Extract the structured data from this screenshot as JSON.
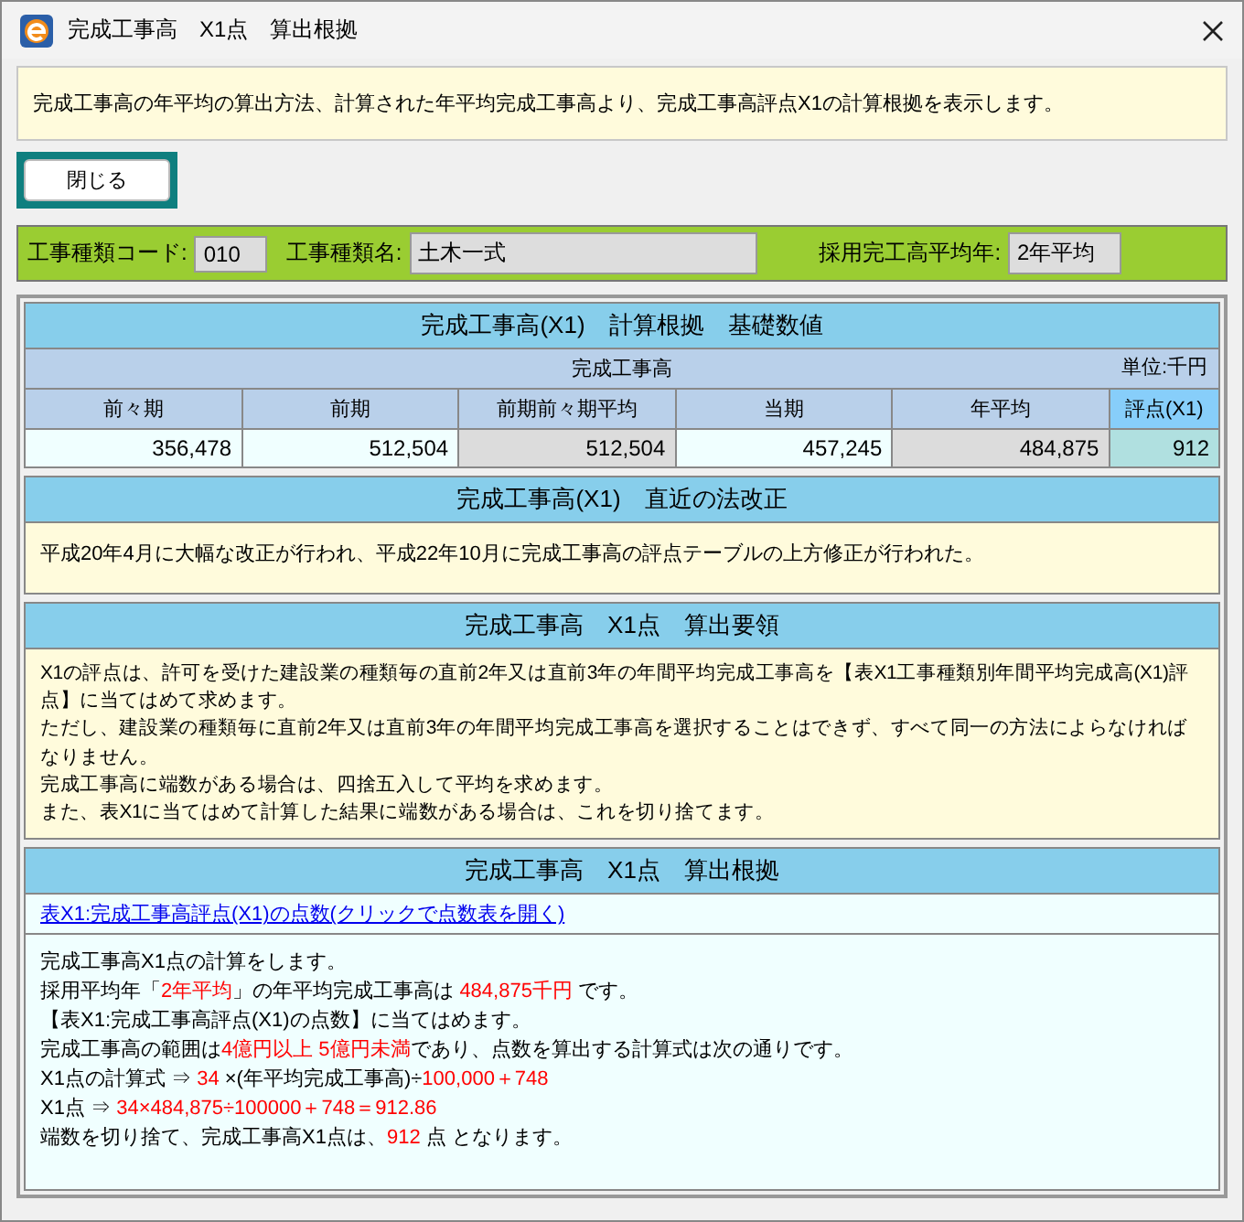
{
  "window": {
    "title": "完成工事高　X1点　算出根拠"
  },
  "description": "完成工事高の年平均の算出方法、計算された年平均完成工事高より、完成工事高評点X1の計算根拠を表示します。",
  "close_button": "閉じる",
  "info_bar": [
    {
      "label": "工事種類コード:",
      "value": "010",
      "kind": "short"
    },
    {
      "label": "工事種類名:",
      "value": "土木一式",
      "kind": "long"
    },
    {
      "label": "採用完工高平均年:",
      "value": "2年平均",
      "kind": "medium"
    }
  ],
  "basis": {
    "title": "完成工事高(X1)　計算根拠　基礎数値",
    "group_label": "完成工事高",
    "unit": "単位:千円",
    "columns": [
      {
        "label": "前々期",
        "value": "356,478",
        "kind": "input"
      },
      {
        "label": "前期",
        "value": "512,504",
        "kind": "input"
      },
      {
        "label": "前期前々期平均",
        "value": "512,504",
        "kind": "computed"
      },
      {
        "label": "当期",
        "value": "457,245",
        "kind": "input"
      },
      {
        "label": "年平均",
        "value": "484,875",
        "kind": "computed"
      },
      {
        "label": "評点(X1)",
        "value": "912",
        "kind": "score"
      }
    ]
  },
  "law": {
    "title": "完成工事高(X1)　直近の法改正",
    "text": "平成20年4月に大幅な改正が行われ、平成22年10月に完成工事高の評点テーブルの上方修正が行われた。"
  },
  "method": {
    "title": "完成工事高　X1点　算出要領",
    "lines": [
      "X1の評点は、許可を受けた建設業の種類毎の直前2年又は直前3年の年間平均完成工事高を【表X1工事種類別年間平均完成高(X1)評点】に当てはめて求めます。",
      "ただし、建設業の種類毎に直前2年又は直前3年の年間平均完成工事高を選択することはできず、すべて同一の方法によらなければなりません。",
      "完成工事高に端数がある場合は、四捨五入して平均を求めます。",
      "また、表X1に当てはめて計算した結果に端数がある場合は、これを切り捨てます。"
    ]
  },
  "calc": {
    "title": "完成工事高　X1点　算出根拠",
    "link": "表X1:完成工事高評点(X1)の点数(クリックで点数表を開く)",
    "lines": [
      [
        {
          "text": "完成工事高X1点の計算をします。",
          "emphasis": false
        }
      ],
      [
        {
          "text": "採用平均年「",
          "emphasis": false
        },
        {
          "text": "2年平均",
          "emphasis": true
        },
        {
          "text": "」の年平均完成工事高は ",
          "emphasis": false
        },
        {
          "text": "484,875千円",
          "emphasis": true
        },
        {
          "text": " です。",
          "emphasis": false
        }
      ],
      [
        {
          "text": "【表X1:完成工事高評点(X1)の点数】に当てはめます。",
          "emphasis": false
        }
      ],
      [
        {
          "text": "完成工事高の範囲は",
          "emphasis": false
        },
        {
          "text": "4億円以上 5億円未満",
          "emphasis": true
        },
        {
          "text": "であり、点数を算出する計算式は次の通りです。",
          "emphasis": false
        }
      ],
      [
        {
          "text": "X1点の計算式 ⇒ ",
          "emphasis": false
        },
        {
          "text": "34",
          "emphasis": true
        },
        {
          "text": " ×(年平均完成工事高)÷",
          "emphasis": false
        },
        {
          "text": "100,000＋748",
          "emphasis": true
        }
      ],
      [
        {
          "text": "X1点 ⇒ ",
          "emphasis": false
        },
        {
          "text": "34×484,875÷100000＋748＝912.86",
          "emphasis": true
        }
      ],
      [
        {
          "text": "端数を切り捨て、完成工事高X1点は、",
          "emphasis": false
        },
        {
          "text": "912",
          "emphasis": true
        },
        {
          "text": " 点 となります。",
          "emphasis": false
        }
      ]
    ]
  }
}
